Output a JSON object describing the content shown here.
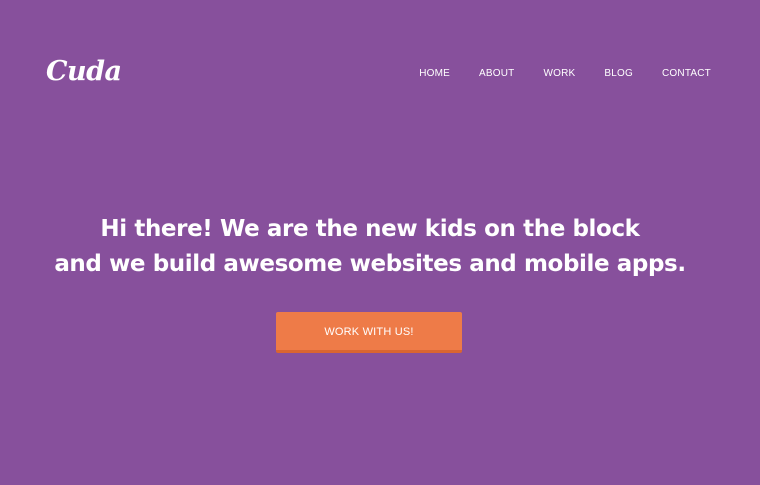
{
  "brand": {
    "logo_text": "Cuda"
  },
  "nav": {
    "items": [
      {
        "label": "HOME"
      },
      {
        "label": "ABOUT"
      },
      {
        "label": "WORK"
      },
      {
        "label": "BLOG"
      },
      {
        "label": "CONTACT"
      }
    ]
  },
  "hero": {
    "headline_line1": "Hi there! We are the new kids on the block",
    "headline_line2": "and we build awesome websites and mobile apps.",
    "cta_label": "WORK WITH US!"
  },
  "colors": {
    "background": "#87509c",
    "accent": "#ee7b48",
    "text": "#ffffff"
  }
}
